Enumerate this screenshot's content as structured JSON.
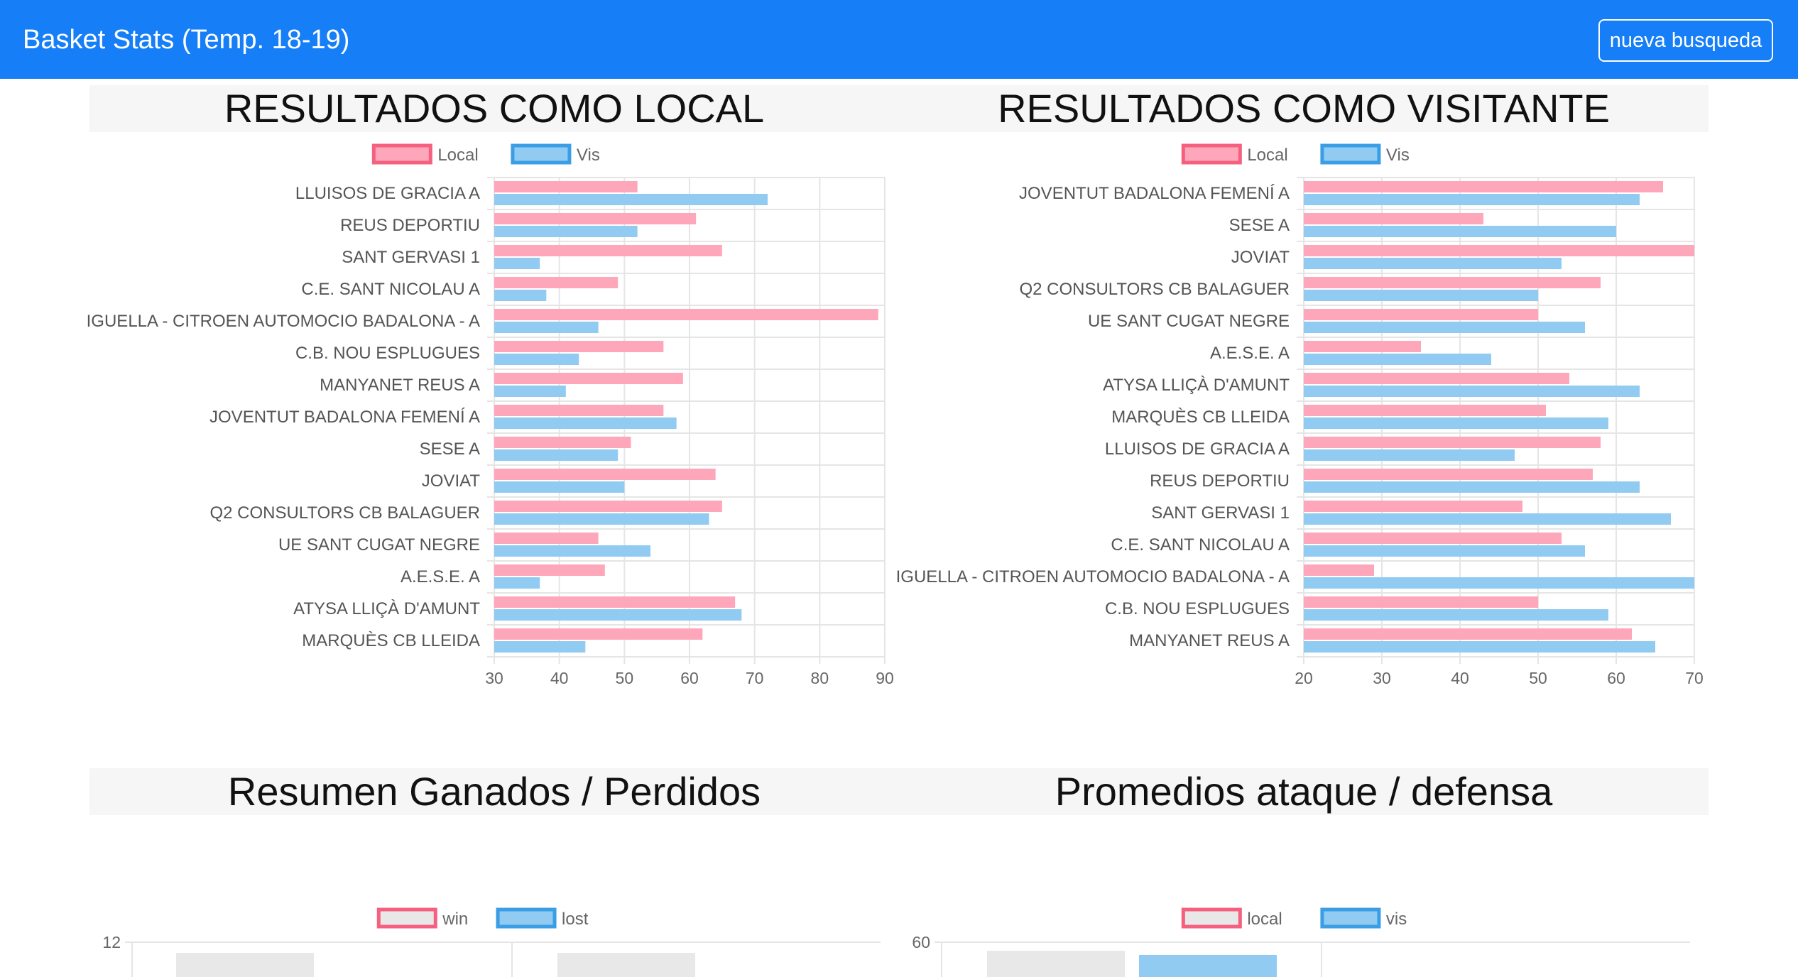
{
  "navbar": {
    "brand": "Basket Stats (Temp. 18-19)",
    "button_label": "nueva busqueda",
    "color": "#167ef7"
  },
  "colors": {
    "local_fill": "#ffa7ba",
    "local_border": "#f5607f",
    "vis_fill": "#92cbf2",
    "vis_border": "#3a9ee6",
    "win_fill": "#e8e8e8",
    "lost_fill": "#92cbf2",
    "grid": "#e5e5e5",
    "tick_text": "#666666",
    "label_text": "#555555"
  },
  "chart_data": [
    {
      "type": "bar",
      "orientation": "horizontal",
      "title": "RESULTADOS COMO LOCAL",
      "categories": [
        "LLUISOS DE GRACIA A",
        "REUS DEPORTIU",
        "SANT GERVASI 1",
        "C.E. SANT NICOLAU A",
        "IGUELLA - CITROEN AUTOMOCIO BADALONA - A",
        "C.B. NOU ESPLUGUES",
        "MANYANET REUS A",
        "JOVENTUT BADALONA FEMENÍ A",
        "SESE A",
        "JOVIAT",
        "Q2 CONSULTORS CB BALAGUER",
        "UE SANT CUGAT NEGRE",
        "A.E.S.E. A",
        "ATYSA LLIÇÀ D'AMUNT",
        "MARQUÈS CB LLEIDA"
      ],
      "series": [
        {
          "name": "Local",
          "values": [
            52,
            61,
            65,
            49,
            89,
            56,
            59,
            56,
            51,
            64,
            65,
            46,
            47,
            67,
            62
          ]
        },
        {
          "name": "Vis",
          "values": [
            72,
            52,
            37,
            38,
            46,
            43,
            41,
            58,
            49,
            50,
            63,
            54,
            37,
            68,
            44
          ]
        }
      ],
      "xlim": [
        30,
        90
      ],
      "xticks": [
        30,
        40,
        50,
        60,
        70,
        80,
        90
      ],
      "grid": true,
      "legend": "top"
    },
    {
      "type": "bar",
      "orientation": "horizontal",
      "title": "RESULTADOS COMO VISITANTE",
      "categories": [
        "JOVENTUT BADALONA FEMENÍ A",
        "SESE A",
        "JOVIAT",
        "Q2 CONSULTORS CB BALAGUER",
        "UE SANT CUGAT NEGRE",
        "A.E.S.E. A",
        "ATYSA LLIÇÀ D'AMUNT",
        "MARQUÈS CB LLEIDA",
        "LLUISOS DE GRACIA A",
        "REUS DEPORTIU",
        "SANT GERVASI 1",
        "C.E. SANT NICOLAU A",
        "IGUELLA - CITROEN AUTOMOCIO BADALONA - A",
        "C.B. NOU ESPLUGUES",
        "MANYANET REUS A"
      ],
      "series": [
        {
          "name": "Local",
          "values": [
            66,
            43,
            70,
            58,
            50,
            35,
            54,
            51,
            58,
            57,
            48,
            53,
            29,
            50,
            62
          ]
        },
        {
          "name": "Vis",
          "values": [
            63,
            60,
            53,
            50,
            56,
            44,
            63,
            59,
            47,
            63,
            67,
            56,
            70,
            59,
            65
          ]
        }
      ],
      "xlim": [
        20,
        70
      ],
      "xticks": [
        20,
        30,
        40,
        50,
        60,
        70
      ],
      "grid": true,
      "legend": "top"
    },
    {
      "type": "bar",
      "title": "Resumen Ganados / Perdidos",
      "series": [
        {
          "name": "win",
          "values": [
            11.7,
            11.7
          ]
        },
        {
          "name": "lost",
          "values": [
            null,
            null
          ]
        }
      ],
      "ytick_top": 12,
      "legend": "top"
    },
    {
      "type": "bar",
      "title": "Promedios ataque / defensa",
      "series": [
        {
          "name": "local",
          "values": [
            58.8
          ]
        },
        {
          "name": "vis",
          "values": [
            58.2
          ]
        }
      ],
      "ytick_top": 60,
      "legend": "top"
    }
  ]
}
